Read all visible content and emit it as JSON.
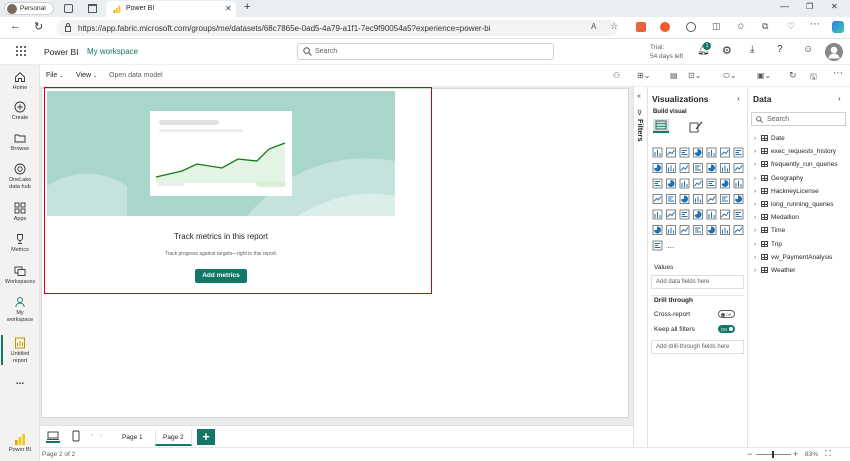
{
  "browser": {
    "profile_label": "Personal",
    "tab_title": "Power BI",
    "url": "https://app.fabric.microsoft.com/groups/me/datasets/68c7865e-0ad5-4a79-a1f1-7ec9f90054a5?experience=power-bi"
  },
  "header": {
    "app_name": "Power BI",
    "workspace": "My workspace",
    "search_placeholder": "Search",
    "trial_line1": "Trial:",
    "trial_line2": "54 days left",
    "notification_count": "1"
  },
  "nav": [
    {
      "label": "Home",
      "icon": "home-icon"
    },
    {
      "label": "Create",
      "icon": "plus-circle-icon"
    },
    {
      "label": "Browse",
      "icon": "folder-icon"
    },
    {
      "label": "OneLake data hub",
      "icon": "onelake-icon"
    },
    {
      "label": "Apps",
      "icon": "apps-icon"
    },
    {
      "label": "Metrics",
      "icon": "trophy-icon"
    },
    {
      "label": "Workspaces",
      "icon": "workspaces-icon"
    },
    {
      "label": "My workspace",
      "icon": "person-icon"
    },
    {
      "label": "Untitled report",
      "icon": "report-icon"
    },
    {
      "label": "...",
      "icon": "more-icon"
    },
    {
      "label": "Power BI",
      "icon": "powerbi-logo-icon"
    }
  ],
  "toolbar": {
    "file": "File",
    "view": "View",
    "open_data_model": "Open data model"
  },
  "card": {
    "title": "Track metrics in this report",
    "subtitle": "Track progress against targets—right in this report.",
    "button": "Add metrics"
  },
  "filters": {
    "label": "Filters"
  },
  "viz": {
    "title": "Visualizations",
    "build_visual": "Build visual",
    "values_label": "Values",
    "values_placeholder": "Add data fields here",
    "drill_through": "Drill through",
    "cross_report": "Cross-report",
    "cross_report_state": "Off",
    "keep_filters": "Keep all filters",
    "keep_filters_state": "On",
    "drill_placeholder": "Add drill-through fields here",
    "more": "..."
  },
  "data": {
    "title": "Data",
    "search_placeholder": "Search",
    "tables": [
      "Date",
      "exec_requests_history",
      "frequently_run_queries",
      "Geography",
      "HackneyLicense",
      "long_running_queries",
      "Medallion",
      "Time",
      "Trip",
      "vw_PaymentAnalysis",
      "Weather"
    ]
  },
  "pages": {
    "tabs": [
      "Page 1",
      "Page 2"
    ],
    "active": "Page 2",
    "add": "+"
  },
  "status": {
    "page_info": "Page 2 of 2",
    "zoom": "83%"
  },
  "colors": {
    "accent": "#117865",
    "selection": "#d0021b",
    "chart_bg": "#a9d6cb",
    "line": "#107c10"
  }
}
